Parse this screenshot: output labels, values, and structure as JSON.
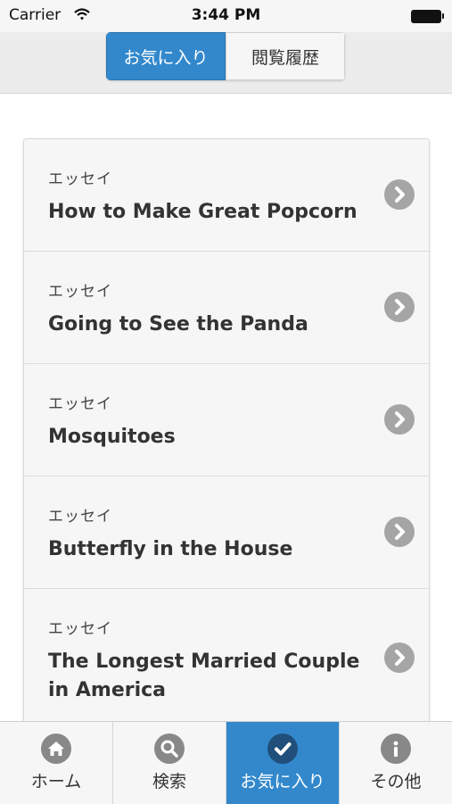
{
  "status_bar": {
    "carrier": "Carrier",
    "time": "3:44 PM"
  },
  "header": {
    "segments": [
      {
        "label": "お気に入り",
        "active": true
      },
      {
        "label": "閲覧履歴",
        "active": false
      }
    ]
  },
  "list": {
    "items": [
      {
        "category": "エッセイ",
        "title": "How to Make Great Popcorn"
      },
      {
        "category": "エッセイ",
        "title": "Going to See the Panda"
      },
      {
        "category": "エッセイ",
        "title": "Mosquitoes"
      },
      {
        "category": "エッセイ",
        "title": "Butterfly in the House"
      },
      {
        "category": "エッセイ",
        "title": "The Longest Married Couple in America"
      }
    ]
  },
  "tab_bar": {
    "tabs": [
      {
        "label": "ホーム",
        "icon": "home-icon",
        "active": false
      },
      {
        "label": "検索",
        "icon": "search-icon",
        "active": false
      },
      {
        "label": "お気に入り",
        "icon": "check-icon",
        "active": true
      },
      {
        "label": "その他",
        "icon": "info-icon",
        "active": false
      }
    ]
  },
  "colors": {
    "accent": "#3388cc",
    "icon_gray": "#a5a5a5"
  }
}
